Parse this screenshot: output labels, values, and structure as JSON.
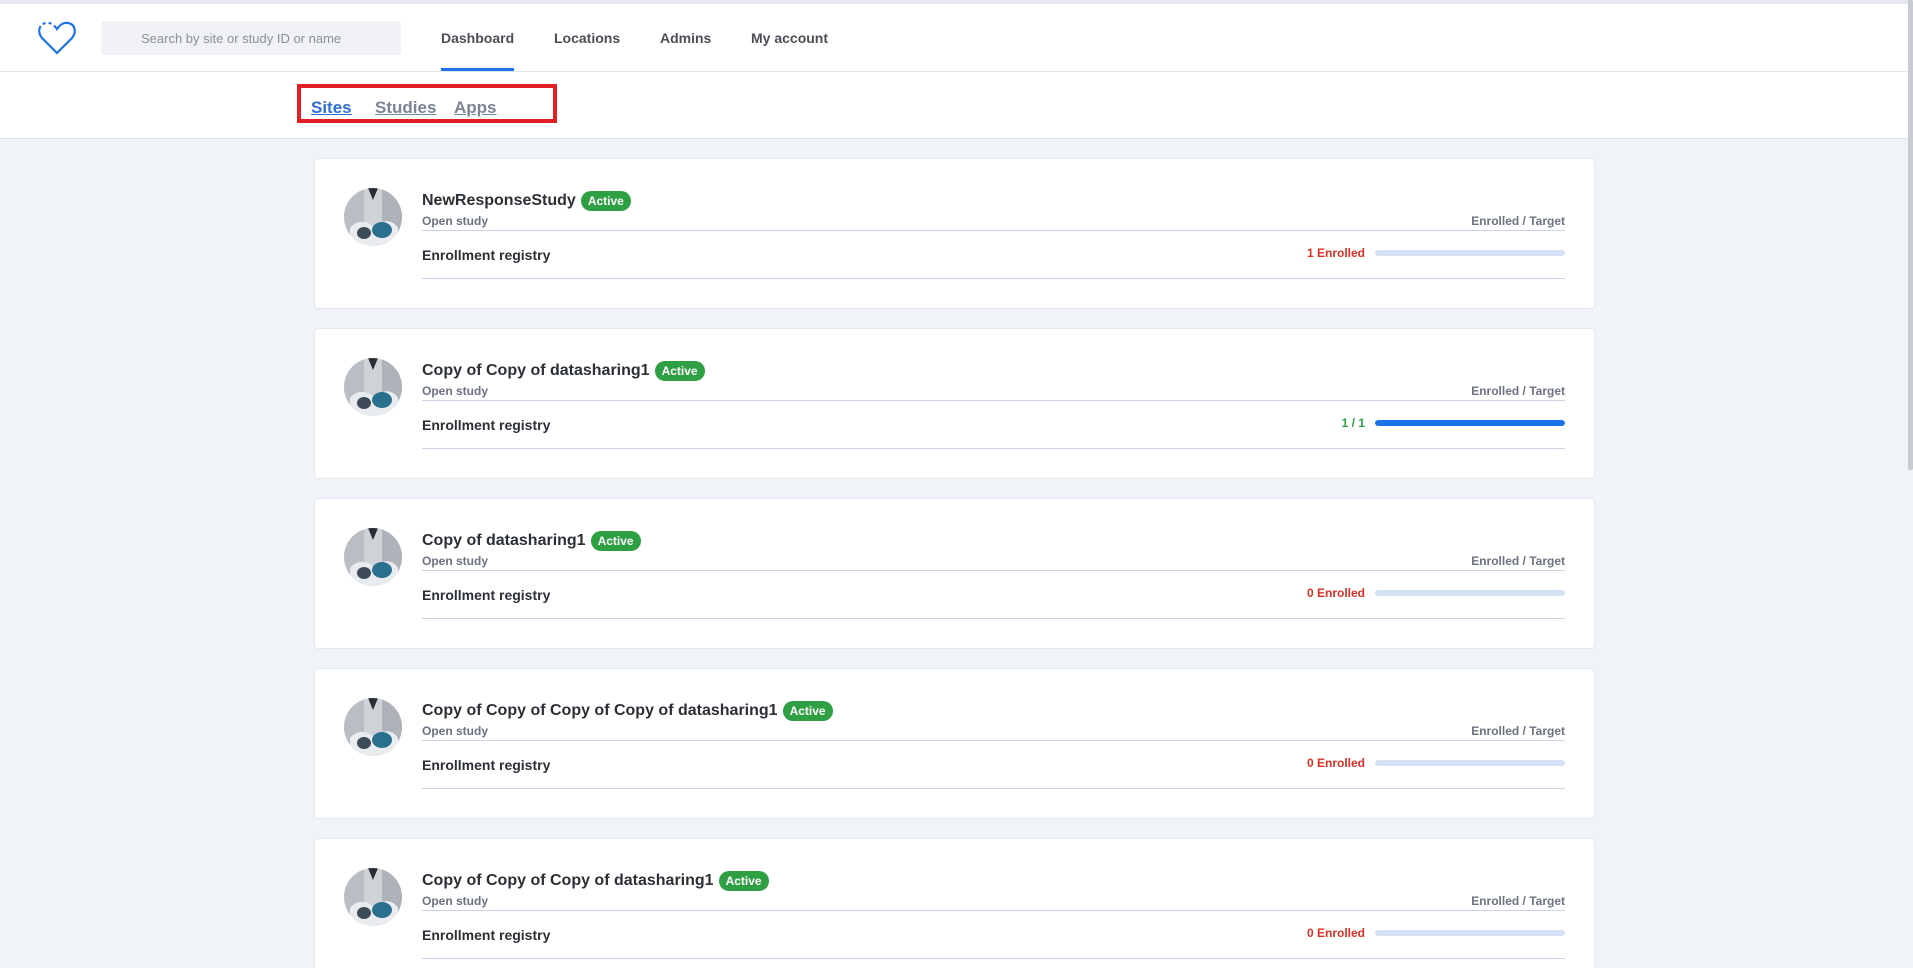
{
  "search": {
    "placeholder": "Search by site or study ID or name"
  },
  "nav": {
    "items": [
      {
        "label": "Dashboard",
        "active": true
      },
      {
        "label": "Locations",
        "active": false
      },
      {
        "label": "Admins",
        "active": false
      },
      {
        "label": "My account",
        "active": false
      }
    ]
  },
  "subtabs": [
    {
      "label": "Sites",
      "active": true
    },
    {
      "label": "Studies",
      "active": false
    },
    {
      "label": "Apps",
      "active": false
    }
  ],
  "colors": {
    "accent": "#1a73e8",
    "badge": "#2ea043",
    "highlight_box": "#e21f26",
    "enrolled_red": "#d93025"
  },
  "studies": [
    {
      "name": "NewResponseStudy",
      "status": "Active",
      "type": "Open study",
      "enr_target_label": "Enrolled / Target",
      "registry": "Enrollment registry",
      "enrolled_text": "1 Enrolled",
      "progress": 0
    },
    {
      "name": "Copy of Copy of datasharing1",
      "status": "Active",
      "type": "Open study",
      "enr_target_label": "Enrolled / Target",
      "registry": "Enrollment registry",
      "enrolled_text": "1 / 1",
      "progress": 1
    },
    {
      "name": "Copy of datasharing1",
      "status": "Active",
      "type": "Open study",
      "enr_target_label": "Enrolled / Target",
      "registry": "Enrollment registry",
      "enrolled_text": "0 Enrolled",
      "progress": 0
    },
    {
      "name": "Copy of Copy of Copy of Copy of datasharing1",
      "status": "Active",
      "type": "Open study",
      "enr_target_label": "Enrolled / Target",
      "registry": "Enrollment registry",
      "enrolled_text": "0 Enrolled",
      "progress": 0
    },
    {
      "name": "Copy of Copy of Copy of datasharing1",
      "status": "Active",
      "type": "Open study",
      "enr_target_label": "Enrolled / Target",
      "registry": "Enrollment registry",
      "enrolled_text": "0 Enrolled",
      "progress": 0
    }
  ]
}
